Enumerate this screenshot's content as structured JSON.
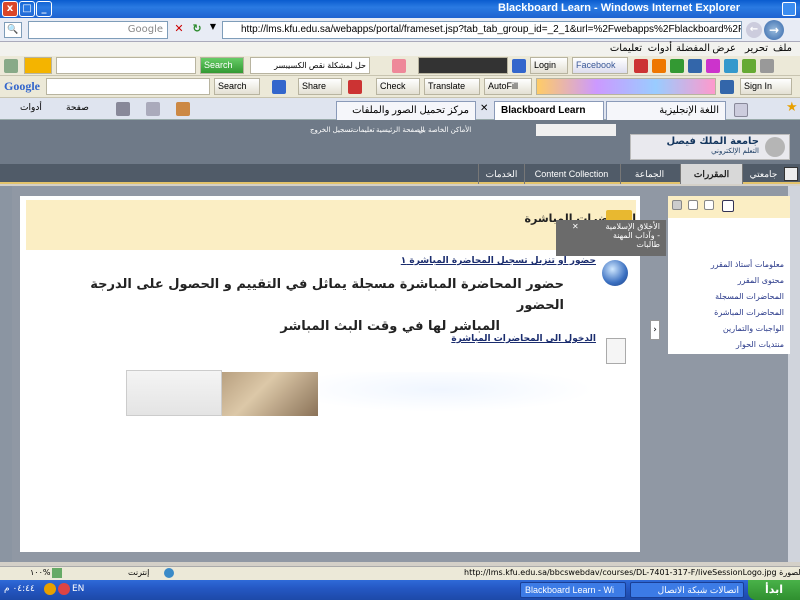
{
  "window": {
    "title": "Blackboard Learn - Windows Internet Explorer",
    "btn_close": "x",
    "btn_max": "□",
    "btn_min": "_"
  },
  "address": {
    "url": "http://lms.kfu.edu.sa/webapps/portal/frameset.jsp?tab_tab_group_id=_2_1&url=%2Fwebapps%2Fblackboard%2Fexecute%2Flauncher%3Ftype%3DCourse",
    "search_placeholder": "Google"
  },
  "menu": {
    "items": [
      "ملف",
      "تحرير",
      "عرض",
      "المفضلة",
      "أدوات",
      "تعليمات"
    ]
  },
  "toolbar1": {
    "search_btn": "Search",
    "ar_box": "حل لمشكلة نقص الكسيبسر",
    "login": "Login",
    "facebook": "Facebook"
  },
  "toolbar2": {
    "brand": "Google",
    "search": "Search",
    "share": "Share",
    "check": "Check",
    "translate": "Translate",
    "autofill": "AutoFill",
    "signin": "Sign In"
  },
  "ie_tabs": {
    "tab1": "اللغة الإنجليزية",
    "tab2": "Blackboard Learn",
    "tab3": "مركز تحميل الصور والملفات",
    "tools_label": "أدوات",
    "page_label": "صفحة"
  },
  "bb_header": {
    "logo_line1": "جامعة الملك فيصل",
    "logo_line2": "التعلم الإلكتروني",
    "links": [
      "الأماكن الخاصة بي",
      "الصفحة الرئيسية",
      "تعليمات",
      "تسجيل الخروج"
    ]
  },
  "bb_nav": {
    "tabs": [
      "جامعتي",
      "المقررات الدراسية",
      "الجماعة",
      "Content Collection",
      "الخدمات"
    ]
  },
  "course_menu": {
    "items": [
      "معلومات أستاذ المقرر",
      "محتوى المقرر",
      "المحاضرات المسجلة",
      "المحاضرات المباشرة",
      "الواجبات والتمارين",
      "منتديات الحوار"
    ]
  },
  "tooltip": {
    "line1": "الأخلاق الإسلامية",
    "line2": "وآداب المهنة -",
    "line3": "طالبات"
  },
  "content": {
    "page_title": "المحاضرات المباشرة",
    "link1": "حضور او تنزيل تسجيل المحاضرة المباشرة ١",
    "notice_line1": "حضور المحاضرة المباشرة مسجلة يماثل في التقييم و الحصول على الدرجة الحضور",
    "notice_line2": "المباشر لها في وقت البث المباشر",
    "link2": "الدخول الى المحاضرات المباشرة"
  },
  "status": {
    "text": "http://lms.kfu.edu.sa/bbcswebdav/courses/DL-7401-317-F/liveSessionLogo.jpg يتم الآن تنزيل الصورة",
    "zone": "إنترنت",
    "zoom": "١٠٠%"
  },
  "taskbar": {
    "clock": "٠٤:٤٤ م",
    "lang": "EN",
    "btn1": "Blackboard Learn - Wi",
    "btn2": "اتصالات شبكة الاتصال",
    "start": "ابدأ"
  }
}
